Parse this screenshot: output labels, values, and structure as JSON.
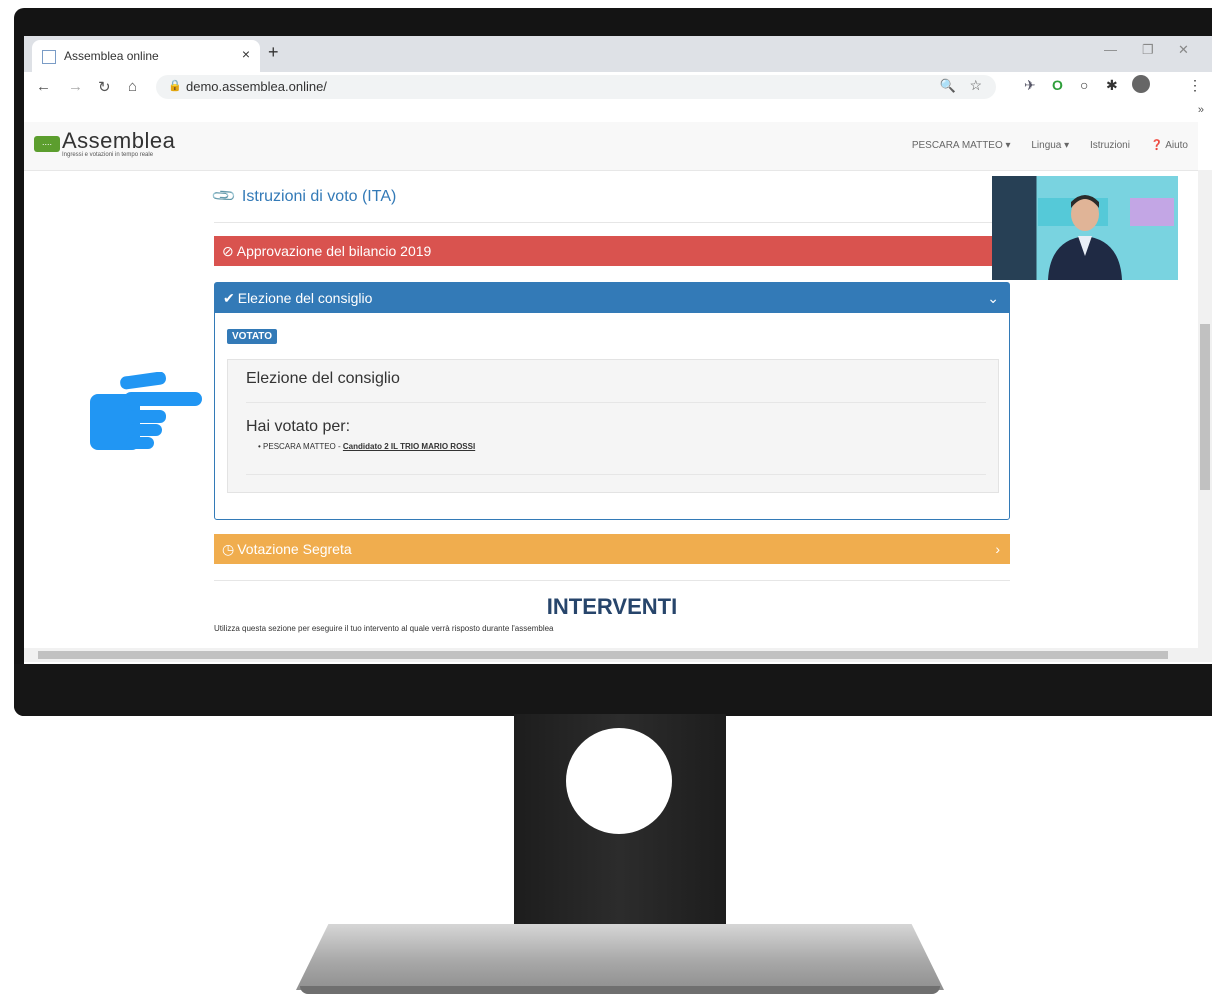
{
  "browser": {
    "tab_title": "Assemblea online",
    "tab_close": "×",
    "new_tab": "+",
    "url": "demo.assemblea.online/",
    "bookmarks_more": "»"
  },
  "site": {
    "logo_name": "Assemblea",
    "logo_tagline": "Ingressi e votazioni in tempo reale",
    "nav": {
      "user": "PESCARA MATTEO ▾",
      "language": "Lingua ▾",
      "instructions": "Istruzioni",
      "help": "Aiuto"
    }
  },
  "content": {
    "instructions_link": "Istruzioni di voto (ITA)",
    "panels": {
      "bilancio": "Approvazione del bilancio 2019",
      "consiglio": "Elezione del consiglio",
      "segreta": "Votazione Segreta"
    },
    "voted_badge": "VOTATO",
    "detail_title": "Elezione del consiglio",
    "voted_for_label": "Hai votato per:",
    "vote_person": "• PESCARA MATTEO - ",
    "vote_choice": "Candidato 2 IL TRIO MARIO ROSSI",
    "interventi_title": "INTERVENTI",
    "interventi_text": "Utilizza questa sezione per eseguire il tuo intervento al quale verrà risposto durante l'assemblea"
  },
  "colors": {
    "danger": "#d9534f",
    "primary": "#337ab7",
    "warning": "#f0ad4e",
    "pointer": "#2196f3"
  }
}
